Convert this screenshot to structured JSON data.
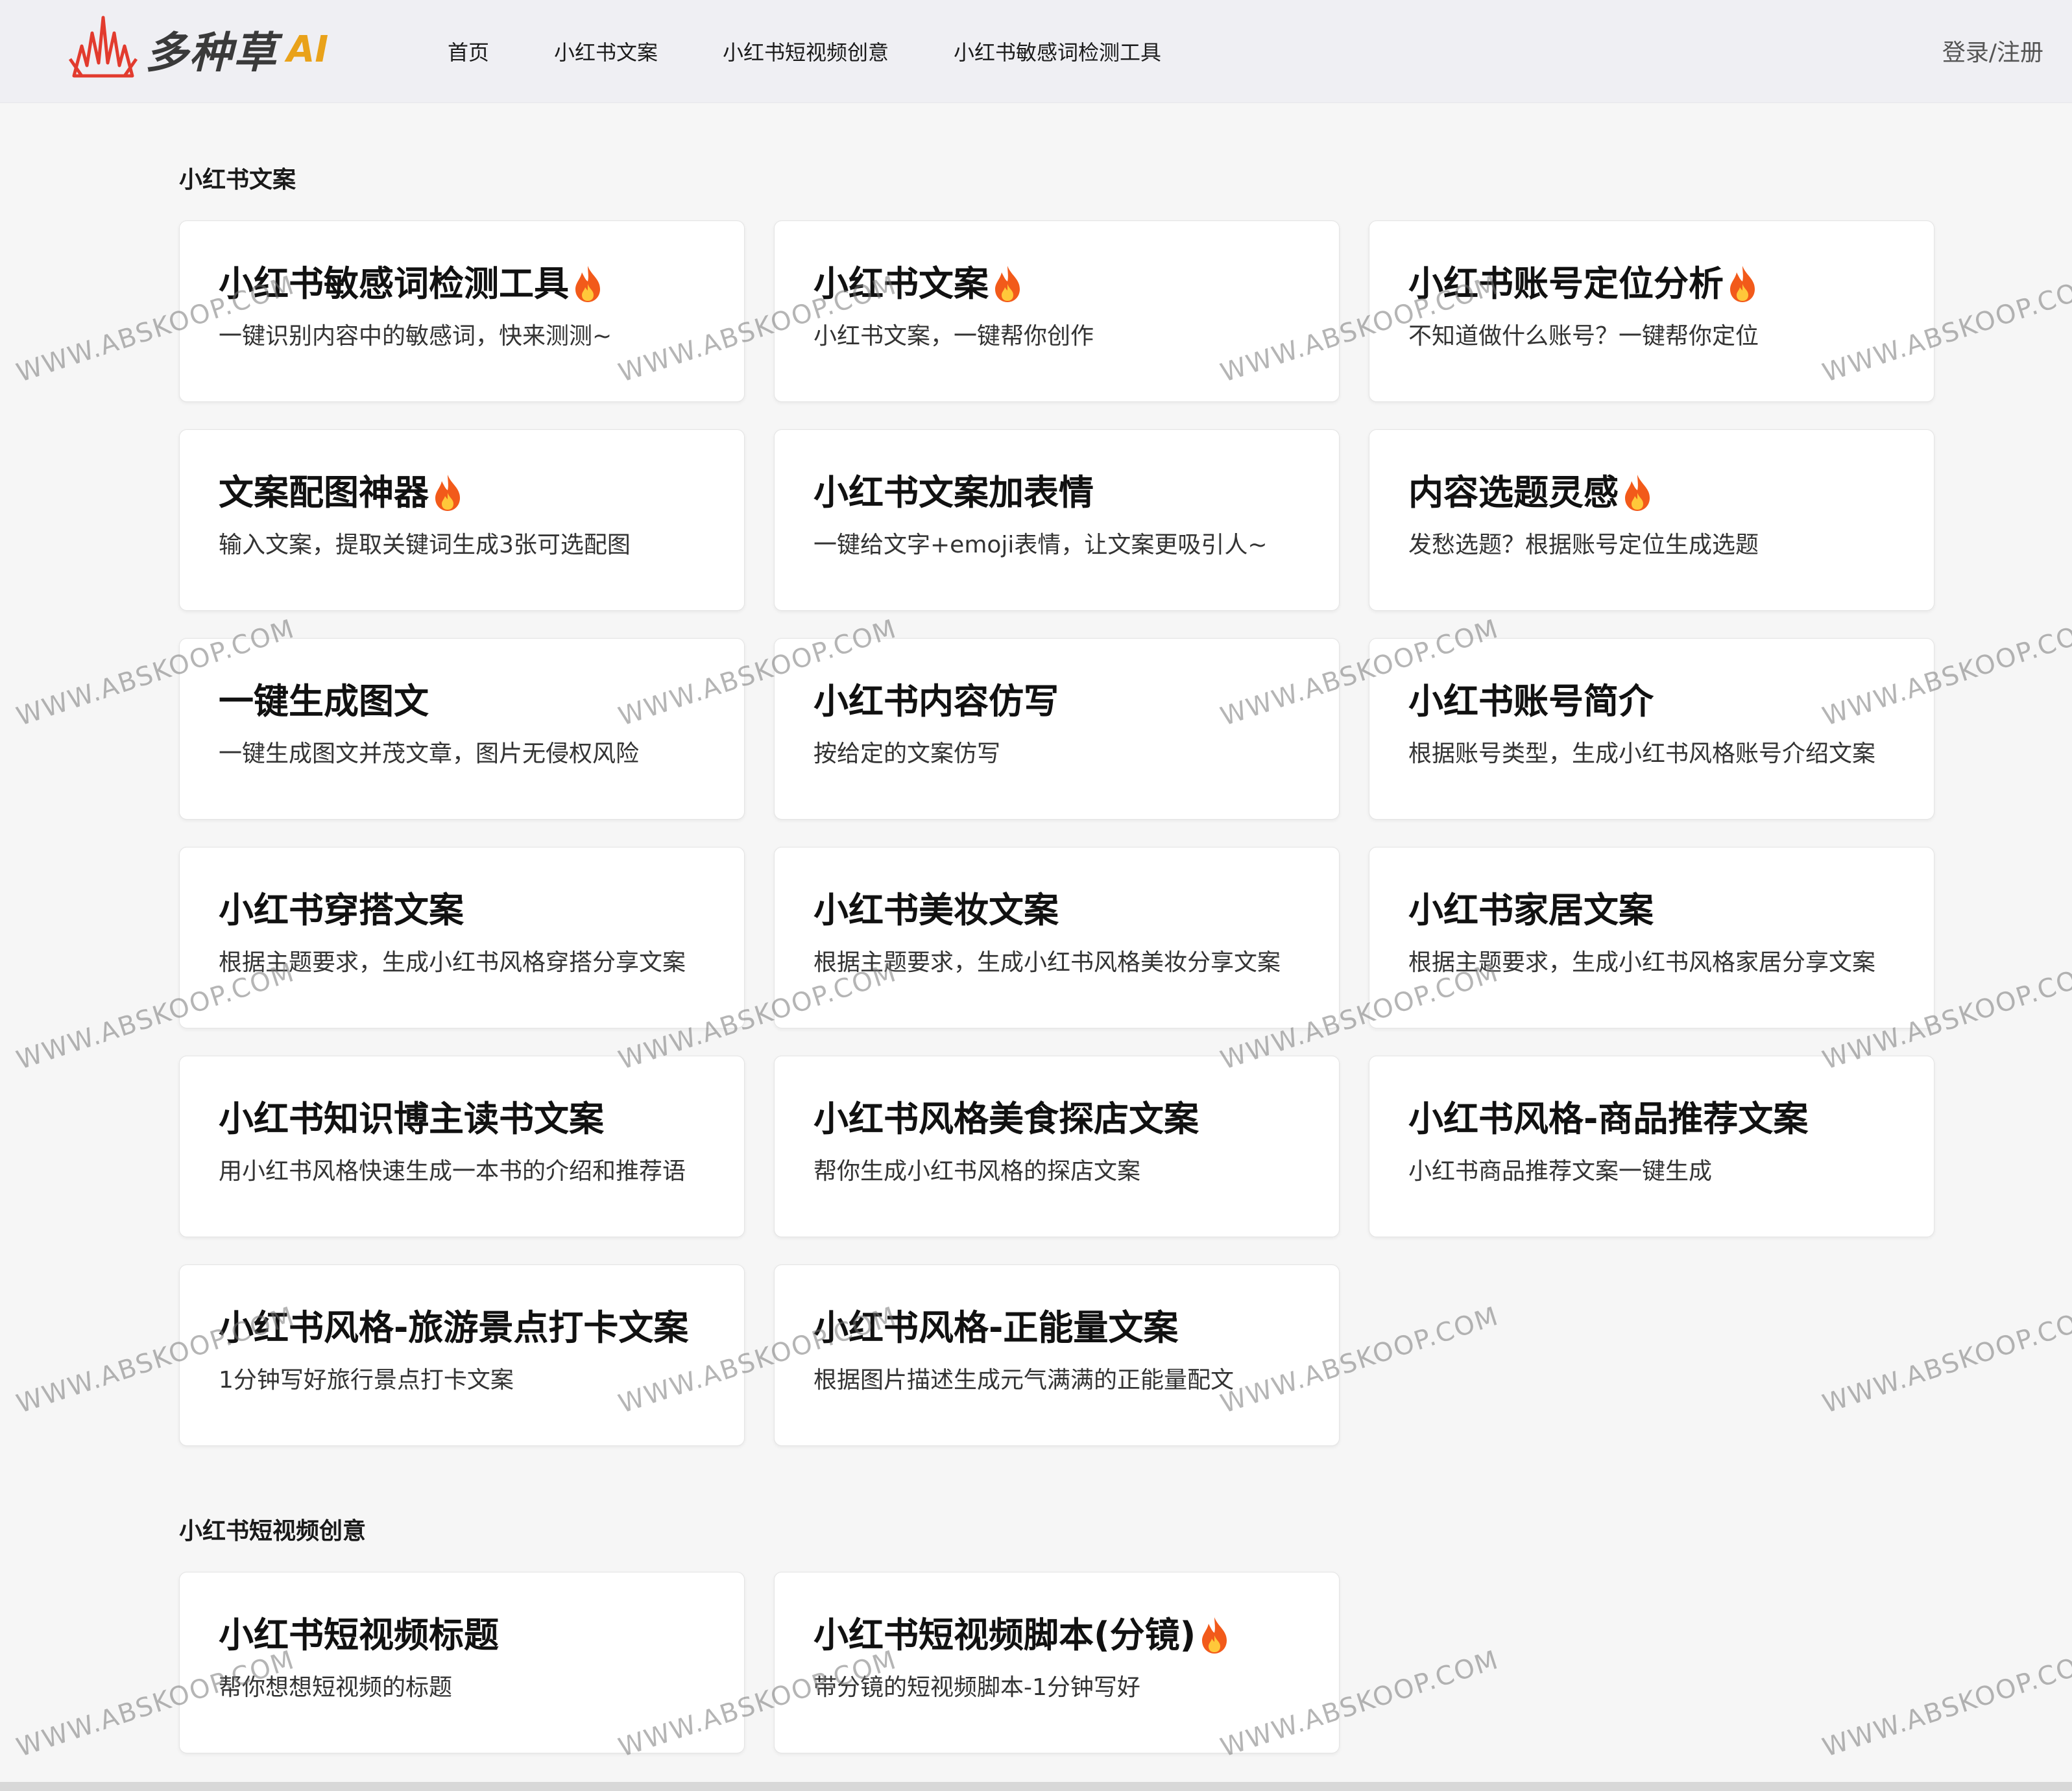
{
  "header": {
    "logo_text": "多种草",
    "logo_ai": "AI",
    "nav": [
      "首页",
      "小红书文案",
      "小红书短视频创意",
      "小红书敏感词检测工具"
    ],
    "login": "登录/注册"
  },
  "sections": [
    {
      "title": "小红书文案",
      "cards": [
        {
          "title": "小红书敏感词检测工具",
          "hot": true,
          "desc": "一键识别内容中的敏感词，快来测测~"
        },
        {
          "title": "小红书文案",
          "hot": true,
          "desc": "小红书文案，一键帮你创作"
        },
        {
          "title": "小红书账号定位分析",
          "hot": true,
          "desc": "不知道做什么账号？一键帮你定位"
        },
        {
          "title": "文案配图神器",
          "hot": true,
          "desc": "输入文案，提取关键词生成3张可选配图"
        },
        {
          "title": "小红书文案加表情",
          "hot": false,
          "desc": "一键给文字+emoji表情，让文案更吸引人~"
        },
        {
          "title": "内容选题灵感",
          "hot": true,
          "desc": "发愁选题？根据账号定位生成选题"
        },
        {
          "title": "一键生成图文",
          "hot": false,
          "desc": "一键生成图文并茂文章，图片无侵权风险"
        },
        {
          "title": "小红书内容仿写",
          "hot": false,
          "desc": "按给定的文案仿写"
        },
        {
          "title": "小红书账号简介",
          "hot": false,
          "desc": "根据账号类型，生成小红书风格账号介绍文案"
        },
        {
          "title": "小红书穿搭文案",
          "hot": false,
          "desc": "根据主题要求，生成小红书风格穿搭分享文案"
        },
        {
          "title": "小红书美妆文案",
          "hot": false,
          "desc": "根据主题要求，生成小红书风格美妆分享文案"
        },
        {
          "title": "小红书家居文案",
          "hot": false,
          "desc": "根据主题要求，生成小红书风格家居分享文案"
        },
        {
          "title": "小红书知识博主读书文案",
          "hot": false,
          "desc": "用小红书风格快速生成一本书的介绍和推荐语"
        },
        {
          "title": "小红书风格美食探店文案",
          "hot": false,
          "desc": "帮你生成小红书风格的探店文案"
        },
        {
          "title": "小红书风格-商品推荐文案",
          "hot": false,
          "desc": "小红书商品推荐文案一键生成"
        },
        {
          "title": "小红书风格-旅游景点打卡文案",
          "hot": false,
          "desc": "1分钟写好旅行景点打卡文案"
        },
        {
          "title": "小红书风格-正能量文案",
          "hot": false,
          "desc": "根据图片描述生成元气满满的正能量配文"
        }
      ]
    },
    {
      "title": "小红书短视频创意",
      "cards": [
        {
          "title": "小红书短视频标题",
          "hot": false,
          "desc": "帮你想想短视频的标题"
        },
        {
          "title": "小红书短视频脚本(分镜)",
          "hot": true,
          "desc": "带分镜的短视频脚本-1分钟写好"
        }
      ]
    }
  ],
  "watermark": "WWW.ABSKOOP.COM",
  "colors": {
    "logo_red": "#e23b2e",
    "logo_ai": "#e9a21a",
    "fire": "#f25a1a"
  }
}
